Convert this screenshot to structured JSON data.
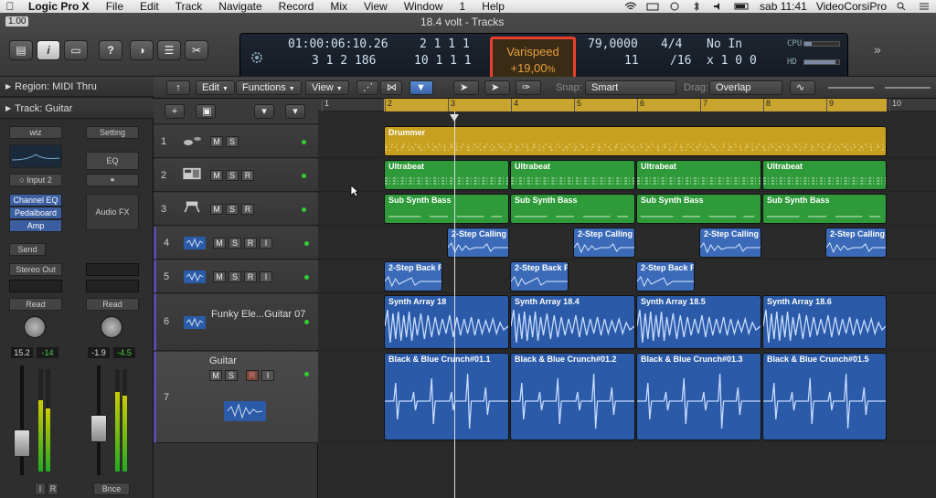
{
  "menu": {
    "app": "Logic Pro X",
    "items": [
      "File",
      "Edit",
      "Track",
      "Navigate",
      "Record",
      "Mix",
      "View",
      "Window",
      "1",
      "Help"
    ],
    "clock": "sab 11:41",
    "user": "VideoCorsiPro"
  },
  "window": {
    "title": "18.4 volt - Tracks",
    "zoom": "1.00"
  },
  "lcd": {
    "time": "01:00:06:10.26",
    "bars": "3  1  2  186",
    "loc1": "2  1  1     1",
    "loc2": "10  1  1     1",
    "varispeed_label": "Varispeed",
    "varispeed_value": "+19,00",
    "varispeed_unit": "%",
    "tempo": "79,0000",
    "sig_top": "4/4",
    "sig_bottom": "/16",
    "extra": "11",
    "in_label": "No In",
    "in_value": "x 1  0  0",
    "cpu_label": "CPU",
    "hd_label": "HD"
  },
  "inspector": {
    "region": "Region: MIDI Thru",
    "track": "Track: Guitar",
    "strip1": {
      "name": "wiz",
      "input": "Input 2",
      "plugins": [
        "Channel EQ",
        "Pedalboard",
        "Amp"
      ],
      "send": "Send",
      "output": "Stereo Out",
      "mode": "Read",
      "vol": "15.2",
      "peak": "-14",
      "btn_i": "I",
      "btn_r": "R"
    },
    "strip2": {
      "name": "Setting",
      "eq": "EQ",
      "fx": "Audio FX",
      "mode": "Read",
      "vol": "-1.9",
      "peak": "-4.5",
      "label": "Bnce"
    }
  },
  "toolbar": {
    "edit": "Edit",
    "functions": "Functions",
    "view": "View",
    "snap_label": "Snap:",
    "snap_value": "Smart",
    "drag_label": "Drag:",
    "drag_value": "Overlap"
  },
  "tracks": [
    {
      "num": "1",
      "name": ""
    },
    {
      "num": "2",
      "name": ""
    },
    {
      "num": "3",
      "name": ""
    },
    {
      "num": "4",
      "name": ""
    },
    {
      "num": "5",
      "name": ""
    },
    {
      "num": "6",
      "name": "Funky Ele...Guitar 07"
    },
    {
      "num": "7",
      "name": "Guitar"
    }
  ],
  "buttons": {
    "m": "M",
    "s": "S",
    "r": "R",
    "i": "I"
  },
  "ruler": [
    "1",
    "2",
    "3",
    "4",
    "5",
    "6",
    "7",
    "8",
    "9",
    "10"
  ],
  "regions": {
    "drummer": "Drummer",
    "ultrabeat": "Ultrabeat",
    "subsynth": "Sub Synth Bass",
    "calling": "2-Step Calling",
    "back": "2-Step Back F",
    "synth": [
      "Synth Array 18",
      "Synth Array 18.4",
      "Synth Array 18.5",
      "Synth Array 18.6"
    ],
    "guitar": [
      "Black & Blue Crunch#01.1",
      "Black & Blue Crunch#01.2",
      "Black & Blue Crunch#01.3",
      "Black & Blue Crunch#01.5"
    ]
  },
  "colors": {
    "accent_red": "#e8402a",
    "drummer": "#c8a020",
    "midi_green": "#2f9a3a",
    "audio_blue": "#2a5aa8"
  }
}
